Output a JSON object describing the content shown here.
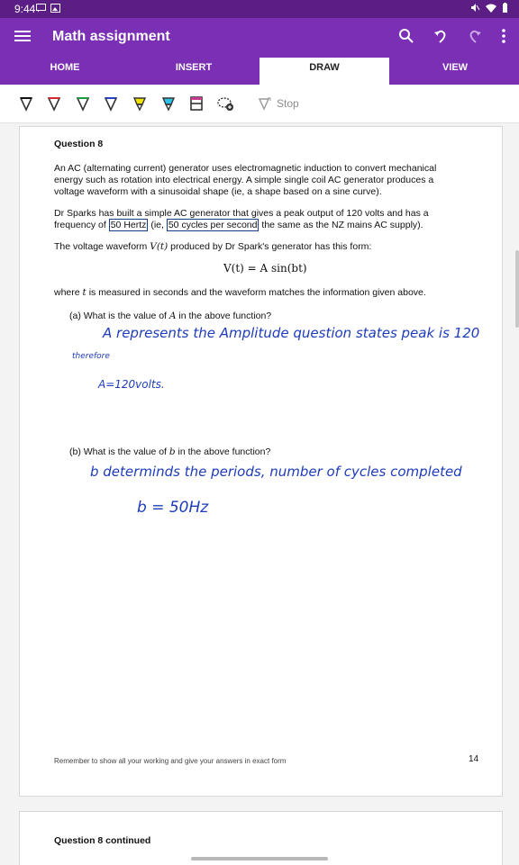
{
  "status": {
    "time": "9:44"
  },
  "app": {
    "title": "Math assignment"
  },
  "tabs": [
    {
      "label": "HOME",
      "active": false
    },
    {
      "label": "INSERT",
      "active": false
    },
    {
      "label": "DRAW",
      "active": true
    },
    {
      "label": "VIEW",
      "active": false
    }
  ],
  "toolbar": {
    "pens": [
      "black-pen-icon",
      "red-pen-icon",
      "green-pen-icon",
      "blue-pen-icon",
      "yellow-highlighter-icon",
      "blue-highlighter-icon",
      "eraser-icon",
      "lasso-icon"
    ],
    "stop_label": "Stop"
  },
  "document": {
    "heading": "Question 8",
    "para1": "An AC (alternating current) generator uses electromagnetic induction to convert mechanical energy such as rotation into electrical energy.  A simple single coil AC generator produces a voltage waveform with a sinusoidal shape  (ie, a shape based on a sine curve).",
    "para2_start": "Dr Sparks has built a simple AC generator that gives a peak output of 120 volts and has a frequency of",
    "para2_box1": "50 Hertz",
    "para2_mid": "(ie,",
    "para2_box2": "50 cycles per second",
    "para2_end": "the same as the NZ mains AC supply).",
    "para3_pre": "The voltage waveform",
    "para3_var": "V(t)",
    "para3_post": "produced by Dr Spark's generator has this form:",
    "formula": "V(t) = A sin(bt)",
    "para4_pre": "where",
    "para4_var": "t",
    "para4_post": "is measured in seconds and the waveform matches the information given above.",
    "qa_pre": "(a) What is the value of",
    "qa_var": "A",
    "qa_post": "in the above function?",
    "qb_pre": "(b) What is the value of",
    "qb_var": "b",
    "qb_post": "in the above function?",
    "footer": "Remember to show all your working and give your answers in exact form",
    "page_number": "14",
    "next_heading": "Question 8 continued"
  },
  "ink": {
    "line1": "A represents the Amplitude question states peak is 120",
    "line2": "therefore",
    "line3": "A=120volts.",
    "line4": "b determinds the periods, number of cycles completed",
    "line5": "b = 50Hz"
  },
  "colors": {
    "purple_dark": "#5b1e85",
    "purple": "#7b2fb5",
    "ink": "#1e3cba"
  }
}
